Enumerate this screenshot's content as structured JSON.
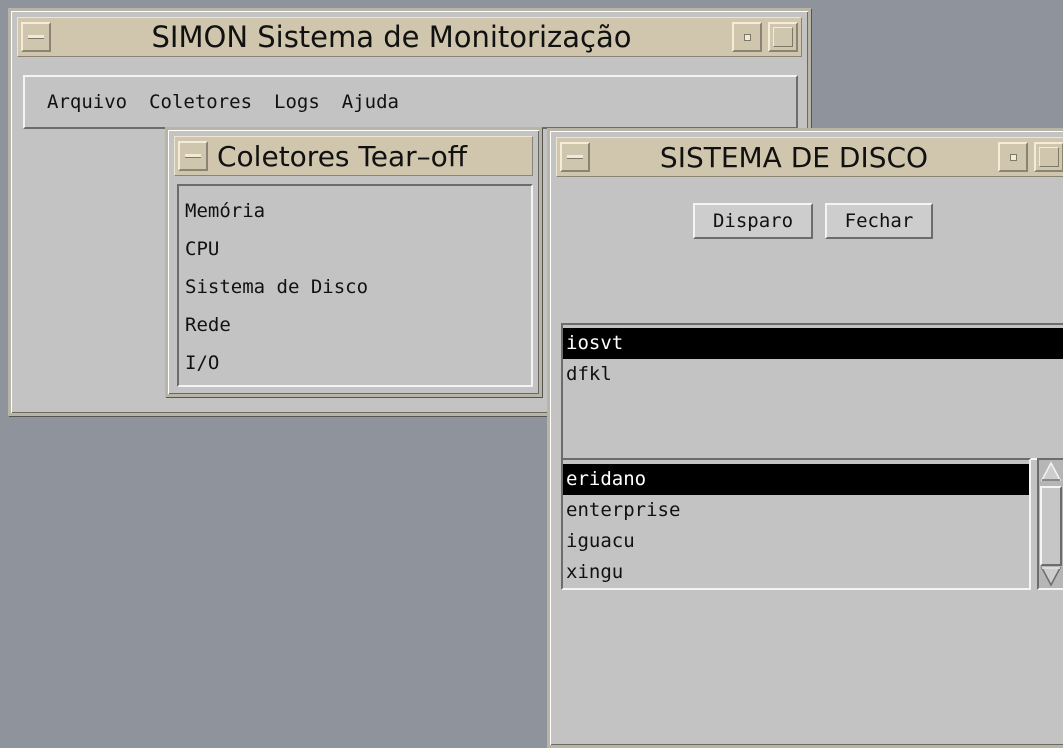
{
  "main_window": {
    "title": "SIMON Sistema de Monitorização",
    "menu": [
      "Arquivo",
      "Coletores",
      "Logs",
      "Ajuda"
    ]
  },
  "tearoff_window": {
    "title": "Coletores Tear–off",
    "items": [
      "Memória",
      "CPU",
      "Sistema de Disco",
      "Rede",
      "I/O"
    ]
  },
  "disk_window": {
    "title": "SISTEMA DE DISCO",
    "buttons": {
      "trigger": "Disparo",
      "close": "Fechar"
    },
    "list_top": {
      "items": [
        "iosvt",
        "dfkl"
      ],
      "selected": "iosvt"
    },
    "list_bottom": {
      "items": [
        "eridano",
        "enterprise",
        "iguacu",
        "xingu"
      ],
      "selected": "eridano"
    }
  },
  "colors": {
    "desktop": "#8f939c",
    "panel": "#c3c3c3",
    "titlebar": "#cfc6ad",
    "selection": "#000000"
  }
}
